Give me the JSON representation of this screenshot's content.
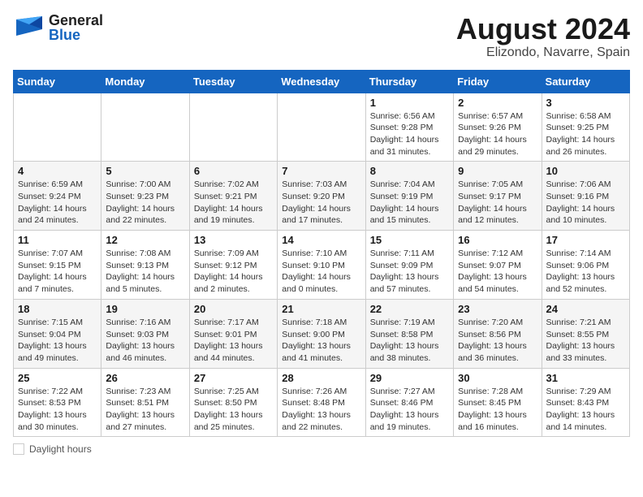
{
  "header": {
    "logo_general": "General",
    "logo_blue": "Blue",
    "month_year": "August 2024",
    "location": "Elizondo, Navarre, Spain"
  },
  "footer": {
    "daylight_label": "Daylight hours"
  },
  "days_of_week": [
    "Sunday",
    "Monday",
    "Tuesday",
    "Wednesday",
    "Thursday",
    "Friday",
    "Saturday"
  ],
  "weeks": [
    [
      {
        "day": "",
        "info": ""
      },
      {
        "day": "",
        "info": ""
      },
      {
        "day": "",
        "info": ""
      },
      {
        "day": "",
        "info": ""
      },
      {
        "day": "1",
        "info": "Sunrise: 6:56 AM\nSunset: 9:28 PM\nDaylight: 14 hours and 31 minutes."
      },
      {
        "day": "2",
        "info": "Sunrise: 6:57 AM\nSunset: 9:26 PM\nDaylight: 14 hours and 29 minutes."
      },
      {
        "day": "3",
        "info": "Sunrise: 6:58 AM\nSunset: 9:25 PM\nDaylight: 14 hours and 26 minutes."
      }
    ],
    [
      {
        "day": "4",
        "info": "Sunrise: 6:59 AM\nSunset: 9:24 PM\nDaylight: 14 hours and 24 minutes."
      },
      {
        "day": "5",
        "info": "Sunrise: 7:00 AM\nSunset: 9:23 PM\nDaylight: 14 hours and 22 minutes."
      },
      {
        "day": "6",
        "info": "Sunrise: 7:02 AM\nSunset: 9:21 PM\nDaylight: 14 hours and 19 minutes."
      },
      {
        "day": "7",
        "info": "Sunrise: 7:03 AM\nSunset: 9:20 PM\nDaylight: 14 hours and 17 minutes."
      },
      {
        "day": "8",
        "info": "Sunrise: 7:04 AM\nSunset: 9:19 PM\nDaylight: 14 hours and 15 minutes."
      },
      {
        "day": "9",
        "info": "Sunrise: 7:05 AM\nSunset: 9:17 PM\nDaylight: 14 hours and 12 minutes."
      },
      {
        "day": "10",
        "info": "Sunrise: 7:06 AM\nSunset: 9:16 PM\nDaylight: 14 hours and 10 minutes."
      }
    ],
    [
      {
        "day": "11",
        "info": "Sunrise: 7:07 AM\nSunset: 9:15 PM\nDaylight: 14 hours and 7 minutes."
      },
      {
        "day": "12",
        "info": "Sunrise: 7:08 AM\nSunset: 9:13 PM\nDaylight: 14 hours and 5 minutes."
      },
      {
        "day": "13",
        "info": "Sunrise: 7:09 AM\nSunset: 9:12 PM\nDaylight: 14 hours and 2 minutes."
      },
      {
        "day": "14",
        "info": "Sunrise: 7:10 AM\nSunset: 9:10 PM\nDaylight: 14 hours and 0 minutes."
      },
      {
        "day": "15",
        "info": "Sunrise: 7:11 AM\nSunset: 9:09 PM\nDaylight: 13 hours and 57 minutes."
      },
      {
        "day": "16",
        "info": "Sunrise: 7:12 AM\nSunset: 9:07 PM\nDaylight: 13 hours and 54 minutes."
      },
      {
        "day": "17",
        "info": "Sunrise: 7:14 AM\nSunset: 9:06 PM\nDaylight: 13 hours and 52 minutes."
      }
    ],
    [
      {
        "day": "18",
        "info": "Sunrise: 7:15 AM\nSunset: 9:04 PM\nDaylight: 13 hours and 49 minutes."
      },
      {
        "day": "19",
        "info": "Sunrise: 7:16 AM\nSunset: 9:03 PM\nDaylight: 13 hours and 46 minutes."
      },
      {
        "day": "20",
        "info": "Sunrise: 7:17 AM\nSunset: 9:01 PM\nDaylight: 13 hours and 44 minutes."
      },
      {
        "day": "21",
        "info": "Sunrise: 7:18 AM\nSunset: 9:00 PM\nDaylight: 13 hours and 41 minutes."
      },
      {
        "day": "22",
        "info": "Sunrise: 7:19 AM\nSunset: 8:58 PM\nDaylight: 13 hours and 38 minutes."
      },
      {
        "day": "23",
        "info": "Sunrise: 7:20 AM\nSunset: 8:56 PM\nDaylight: 13 hours and 36 minutes."
      },
      {
        "day": "24",
        "info": "Sunrise: 7:21 AM\nSunset: 8:55 PM\nDaylight: 13 hours and 33 minutes."
      }
    ],
    [
      {
        "day": "25",
        "info": "Sunrise: 7:22 AM\nSunset: 8:53 PM\nDaylight: 13 hours and 30 minutes."
      },
      {
        "day": "26",
        "info": "Sunrise: 7:23 AM\nSunset: 8:51 PM\nDaylight: 13 hours and 27 minutes."
      },
      {
        "day": "27",
        "info": "Sunrise: 7:25 AM\nSunset: 8:50 PM\nDaylight: 13 hours and 25 minutes."
      },
      {
        "day": "28",
        "info": "Sunrise: 7:26 AM\nSunset: 8:48 PM\nDaylight: 13 hours and 22 minutes."
      },
      {
        "day": "29",
        "info": "Sunrise: 7:27 AM\nSunset: 8:46 PM\nDaylight: 13 hours and 19 minutes."
      },
      {
        "day": "30",
        "info": "Sunrise: 7:28 AM\nSunset: 8:45 PM\nDaylight: 13 hours and 16 minutes."
      },
      {
        "day": "31",
        "info": "Sunrise: 7:29 AM\nSunset: 8:43 PM\nDaylight: 13 hours and 14 minutes."
      }
    ]
  ]
}
